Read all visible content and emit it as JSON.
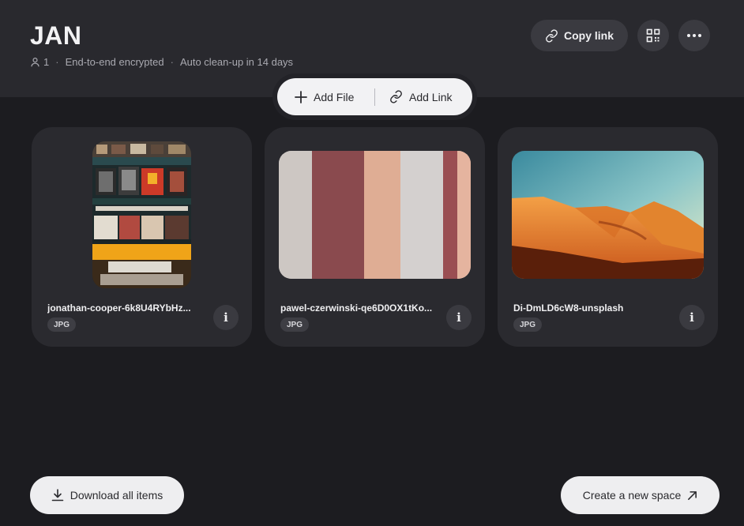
{
  "space": {
    "title": "JAN",
    "member_count": "1",
    "encryption": "End-to-end encrypted",
    "cleanup": "Auto clean-up in 14 days"
  },
  "header_actions": {
    "copy_link_label": "Copy link",
    "qr_icon": "qr-code-icon",
    "more_icon": "more-horizontal-icon"
  },
  "add_bar": {
    "add_file_label": "Add File",
    "add_link_label": "Add Link"
  },
  "files": [
    {
      "name": "jonathan-cooper-6k8U4RYbHz...",
      "type": "JPG"
    },
    {
      "name": "pawel-czerwinski-qe6D0OX1tKo...",
      "type": "JPG"
    },
    {
      "name": "Di-DmLD6cW8-unsplash",
      "type": "JPG"
    }
  ],
  "footer": {
    "download_all_label": "Download all items",
    "create_space_label": "Create a new space"
  },
  "colors": {
    "background": "#1c1c20",
    "header": "#29292e",
    "card": "#2a2a2f",
    "button_dark": "#3a3a40",
    "button_light": "#eeeef0"
  }
}
